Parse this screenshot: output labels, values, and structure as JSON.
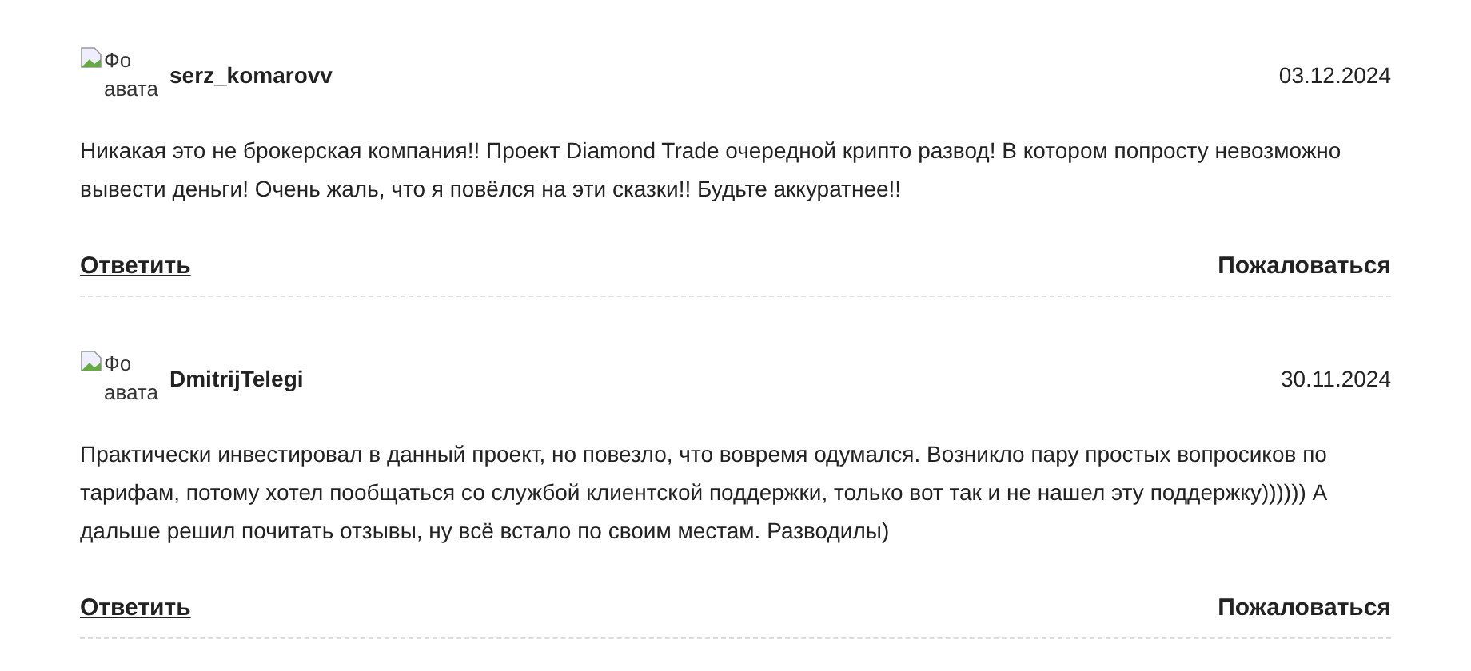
{
  "comments": [
    {
      "avatar_alt": "Фо авата",
      "author": "serz_komarovv",
      "date": "03.12.2024",
      "text": "Никакая это не брокерская компания!! Проект Diamond Trade очередной крипто развод! В котором попросту невозможно вывести деньги! Очень жаль, что я повёлся на эти сказки!! Будьте аккуратнее!!",
      "reply": "Ответить",
      "report": "Пожаловаться"
    },
    {
      "avatar_alt": "Фо авата",
      "author": "DmitrijTelegi",
      "date": "30.11.2024",
      "text": "Практически инвестировал в данный проект, но повезло, что вовремя одумался. Возникло пару простых вопросиков по тарифам, потому хотел пообщаться со службой клиентской поддержки, только вот так и не нашел эту поддержку)))))) А дальше решил почитать отзывы, ну всё встало по своим местам. Разводилы)",
      "reply": "Ответить",
      "report": "Пожаловаться"
    }
  ]
}
